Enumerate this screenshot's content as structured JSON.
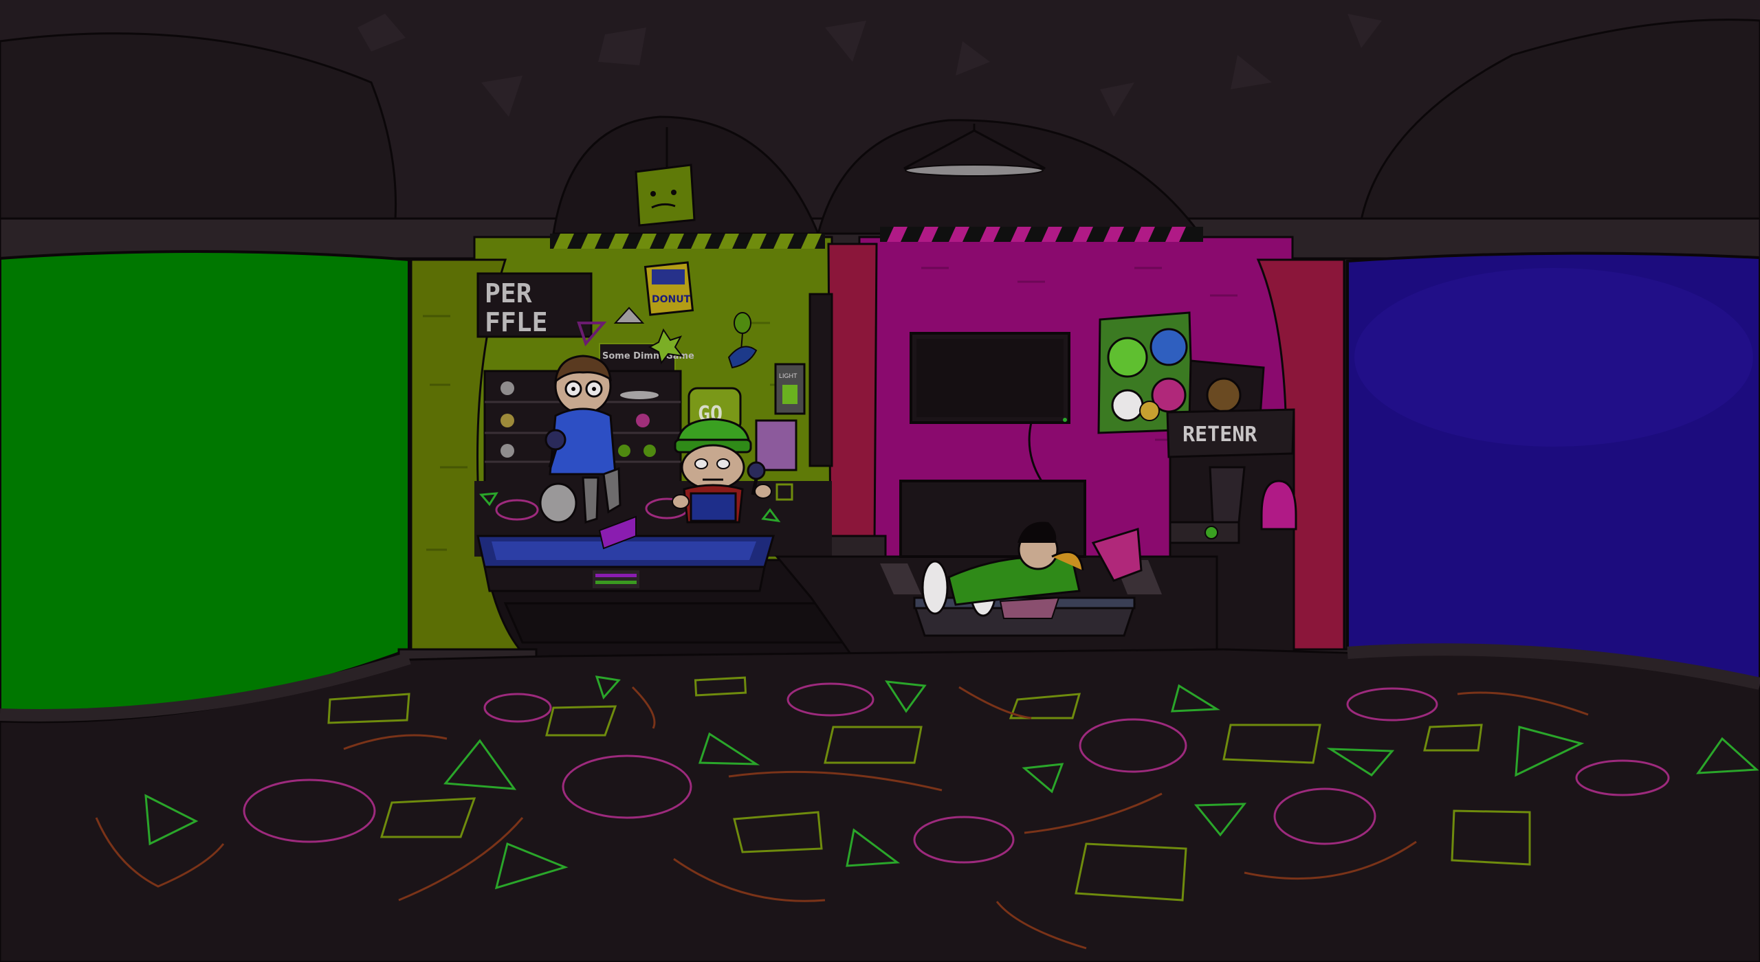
{
  "game": {
    "name": "",
    "stage": {
      "sign_text": [
        "PER",
        "FFLE"
      ],
      "sticker_text": "Some Dimm Game",
      "poster_donut": "DONUT",
      "go_sign": "GO",
      "switch_label": "LIGHT",
      "arcade_marquee": "RETENR"
    },
    "colors": {
      "left_screen": "#007700",
      "right_screen": "#1c0c7e",
      "green_room": "#5f7a08",
      "pink_room": "#8a0a6e",
      "floor": "#1b1418",
      "ceiling": "#221a1f"
    },
    "characters": [
      {
        "id": "player",
        "icon": "microphone-icon"
      },
      {
        "id": "opponent",
        "icon": "microphone-icon"
      },
      {
        "id": "girlfriend-lying",
        "icon": "speaker-box-icon"
      }
    ]
  }
}
